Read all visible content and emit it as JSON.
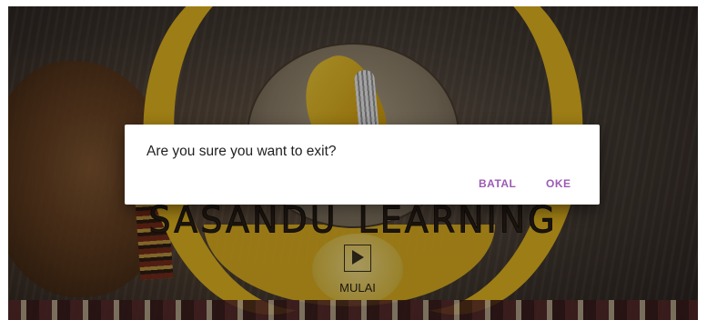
{
  "app": {
    "logo_text": "SASANDU_LEARNING",
    "play_button_label": "MULAI"
  },
  "dialog": {
    "message": "Are you sure you want to exit?",
    "cancel_label": "BATAL",
    "ok_label": "OKE"
  },
  "colors": {
    "accent": "#9c5bb5",
    "emblem_yellow": "#e8b820",
    "dialog_background": "#ffffff"
  },
  "icons": {
    "play": "play-icon"
  }
}
